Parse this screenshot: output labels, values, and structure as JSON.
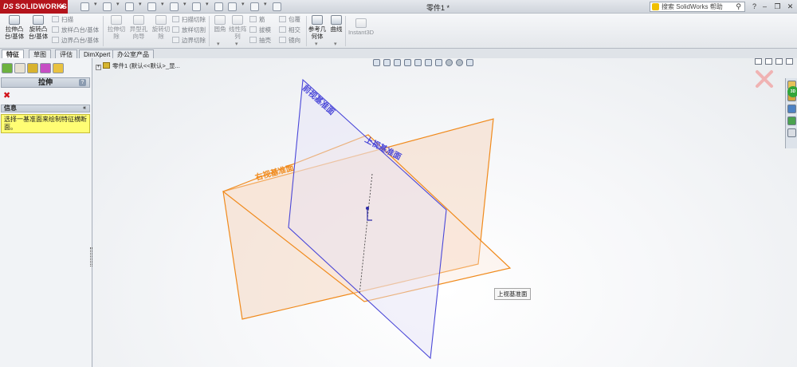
{
  "app": {
    "logo": "SOLIDWORKS",
    "document_title": "零件1 *"
  },
  "search": {
    "placeholder": "搜索 SolidWorks 帮助"
  },
  "command_manager": {
    "extrude_boss": "拉伸凸\n台/基体",
    "revolve_boss": "旋转凸\n台/基体",
    "sweep": "扫描",
    "loft": "放样凸台/基体",
    "boundary": "边界凸台/基体",
    "extruded_cut": "拉伸切\n除",
    "hole_wizard": "异型孔\n向导",
    "revolved_cut": "旋转切\n除",
    "swept_cut": "扫描切除",
    "lofted_cut": "放样切割",
    "boundary_cut": "边界切除",
    "fillet": "圆角",
    "linear_pattern": "线性阵\n列",
    "rib": "筋",
    "draft": "拔模",
    "shell": "抽壳",
    "wrap": "包覆",
    "intersect": "相交",
    "mirror": "镜向",
    "ref_geometry": "参考几\n何体",
    "curves": "曲线",
    "instant3d": "Instant3D"
  },
  "tabs": [
    "特征",
    "草图",
    "评估",
    "DimXpert",
    "办公室产品"
  ],
  "property_manager": {
    "title": "拉伸",
    "help": "?",
    "info_header": "信息",
    "info_text": "选择一基准面来绘制特征横断面。"
  },
  "feature_tree": {
    "root": "零件1 (默认<<默认>_显..."
  },
  "graphics": {
    "planes": {
      "front": "前视基准面",
      "top": "上视基准面",
      "right": "右视基准面"
    },
    "tooltip": "上视基准面"
  },
  "colors": {
    "accent_red": "#b4141c",
    "front_plane": "#4a47d8",
    "right_plane": "#f08a1c",
    "info_yellow": "#fffd74"
  }
}
